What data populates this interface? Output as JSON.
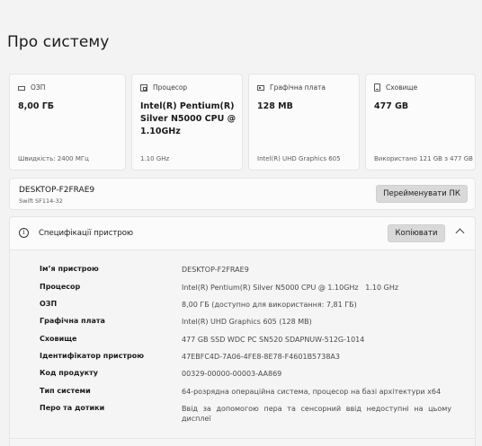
{
  "page": {
    "title": "Про систему"
  },
  "cards": [
    {
      "icon": "ram-icon",
      "label": "ОЗП",
      "value": "8,00 ГБ",
      "sub": "Швидкість: 2400 МГц"
    },
    {
      "icon": "processor-icon",
      "label": "Процесор",
      "value": "Intel(R) Pentium(R) Silver N5000 CPU @ 1.10GHz",
      "sub": "1.10 GHz"
    },
    {
      "icon": "graphics-card-icon",
      "label": "Графічна плата",
      "value": "128 MB",
      "sub": "Intel(R) UHD Graphics 605"
    },
    {
      "icon": "storage-icon",
      "label": "Сховище",
      "value": "477 GB",
      "sub": "Використано 121 GB з 477 GB"
    }
  ],
  "device": {
    "name": "DESKTOP-F2FRAE9",
    "model": "Swift SF114-32",
    "rename_label": "Перейменувати ПК"
  },
  "specs": {
    "title": "Специфікації пристрою",
    "copy_label": "Копіювати",
    "rows": [
      {
        "key": "Ім’я пристрою",
        "value": "DESKTOP-F2FRAE9"
      },
      {
        "key": "Процесор",
        "value": "Intel(R) Pentium(R) Silver N5000 CPU @ 1.10GHz   1.10 GHz"
      },
      {
        "key": "ОЗП",
        "value": "8,00 ГБ (доступно для використання: 7,81 ГБ)"
      },
      {
        "key": "Графічна плата",
        "value": "Intel(R) UHD Graphics 605 (128 MB)"
      },
      {
        "key": "Сховище",
        "value": "477 GB SSD WDC PC SN520 SDAPNUW-512G-1014"
      },
      {
        "key": "Ідентифікатор пристрою",
        "value": "47EBFC4D-7A06-4FE8-8E78-F4601B5738A3"
      },
      {
        "key": "Код продукту",
        "value": "00329-00000-00003-AA869"
      },
      {
        "key": "Тип системи",
        "value": "64-розрядна операційна система, процесор на базі архітектури x64"
      },
      {
        "key": "Перо та дотики",
        "value": "Ввід за допомогою пера та сенсорний ввід недоступні на цьому дисплеї"
      }
    ]
  }
}
